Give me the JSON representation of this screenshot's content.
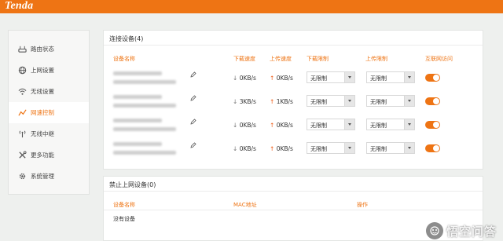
{
  "header": {
    "brand": "Tenda"
  },
  "sidebar": {
    "items": [
      {
        "label": "路由状态",
        "icon": "router-status-icon"
      },
      {
        "label": "上网设置",
        "icon": "globe-icon"
      },
      {
        "label": "无线设置",
        "icon": "wifi-icon"
      },
      {
        "label": "网速控制",
        "icon": "speed-chart-icon",
        "active": true
      },
      {
        "label": "无线中继",
        "icon": "relay-icon"
      },
      {
        "label": "更多功能",
        "icon": "tools-icon"
      },
      {
        "label": "系统管理",
        "icon": "gear-icon"
      }
    ]
  },
  "connected": {
    "title": "连接设备(4)",
    "headers": {
      "name": "设备名称",
      "down_speed": "下载速度",
      "up_speed": "上传速度",
      "down_limit": "下载限制",
      "up_limit": "上传限制",
      "internet": "互联网访问"
    },
    "rows": [
      {
        "down_arrow": "↓",
        "down": "0KB/s",
        "up_arrow": "↑",
        "up": "0KB/s",
        "down_limit": "无限制",
        "up_limit": "无限制",
        "internet_on": true
      },
      {
        "down_arrow": "↓",
        "down": "3KB/s",
        "up_arrow": "↑",
        "up": "1KB/s",
        "down_limit": "无限制",
        "up_limit": "无限制",
        "internet_on": true
      },
      {
        "down_arrow": "↓",
        "down": "0KB/s",
        "up_arrow": "↑",
        "up": "0KB/s",
        "down_limit": "无限制",
        "up_limit": "无限制",
        "internet_on": true
      },
      {
        "down_arrow": "↓",
        "down": "0KB/s",
        "up_arrow": "↑",
        "up": "0KB/s",
        "down_limit": "无限制",
        "up_limit": "无限制",
        "internet_on": true
      }
    ]
  },
  "blocked": {
    "title": "禁止上网设备(0)",
    "headers": {
      "name": "设备名称",
      "mac": "MAC地址",
      "action": "操作"
    },
    "empty_text": "没有设备"
  },
  "watermark": {
    "text": "悟空问答"
  }
}
